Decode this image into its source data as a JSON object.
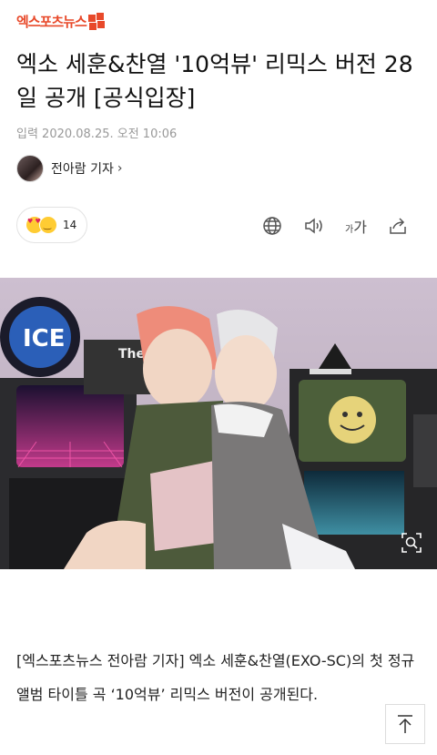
{
  "brand": {
    "logo_text": "엑스포츠뉴스",
    "accent": "#e8492a"
  },
  "article": {
    "headline": "엑소 세훈&찬열 '10억뷰' 리믹스 버전 28일 공개 [공식입장]",
    "dateline": "입력 2020.08.25. 오전 10:06",
    "reporter": "전아람 기자",
    "reporter_chevron": "›",
    "reaction_count": "14",
    "body": "[엑스포츠뉴스 전아람 기자] 엑소 세훈&찬열(EXO-SC)의 첫 정규 앨범 타이틀 곡 ‘10억뷰’ 리믹스 버전이 공개된다."
  },
  "toolbar": {
    "font_size_label_small": "가",
    "font_size_label_large": "가",
    "icons": [
      "globe-icon",
      "speaker-icon",
      "font-size-icon",
      "share-icon"
    ]
  },
  "image": {
    "sign_text": "ICE",
    "sign_text2": "The"
  },
  "colors": {
    "text": "#111111",
    "muted": "#999999",
    "border": "#e3e3e3"
  }
}
